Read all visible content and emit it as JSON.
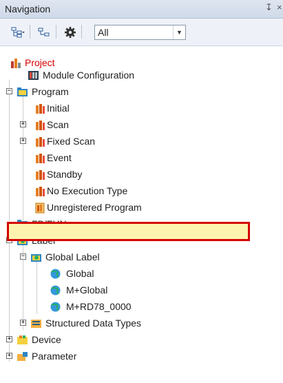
{
  "panel": {
    "title": "Navigation",
    "pin_glyph": "↧",
    "close_glyph": "×"
  },
  "toolbar": {
    "buttons": [
      {
        "icon": "tree-view-icon"
      },
      {
        "icon": "collapse-tree-icon"
      },
      {
        "icon": "gear-icon"
      }
    ],
    "filter_value": "All"
  },
  "tree": {
    "project": "Project",
    "module_configuration": "Module Configuration",
    "program": "Program",
    "initial": "Initial",
    "scan": "Scan",
    "fixed_scan": "Fixed Scan",
    "event": "Event",
    "standby": "Standby",
    "no_execution_type": "No Execution Type",
    "unregistered_program": "Unregistered Program",
    "fb_fun": "FB/FUN",
    "label": "Label",
    "global_label": "Global Label",
    "global": "Global",
    "m_global": "M+Global",
    "m_rd78": "M+RD78_0000",
    "structured_data_types": "Structured Data Types",
    "device": "Device",
    "parameter": "Parameter"
  },
  "colors": {
    "highlight_border": "#d40000",
    "highlight_fill": "#fff3b0",
    "project_text": "#d80000"
  }
}
